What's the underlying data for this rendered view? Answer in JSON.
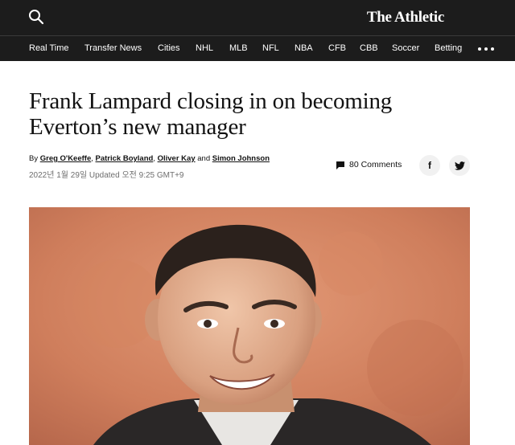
{
  "header": {
    "logo": "The Athletic",
    "search_icon": "search-icon"
  },
  "nav": {
    "items": [
      {
        "label": "Real Time"
      },
      {
        "label": "Transfer News"
      },
      {
        "label": "Cities"
      },
      {
        "label": "NHL"
      },
      {
        "label": "MLB"
      },
      {
        "label": "NFL"
      },
      {
        "label": "NBA"
      },
      {
        "label": "CFB"
      },
      {
        "label": "CBB"
      },
      {
        "label": "Soccer"
      },
      {
        "label": "Betting"
      }
    ],
    "more_icon": "more-icon"
  },
  "article": {
    "headline": "Frank Lampard closing in on becoming Everton’s new manager",
    "byline": {
      "prefix": "By",
      "authors": [
        "Greg O'Keeffe",
        "Patrick Boyland",
        "Oliver Kay",
        "Simon Johnson"
      ],
      "sep1": ",",
      "sep2": ",",
      "and": "and"
    },
    "timestamp": "2022년 1월 29일 Updated 오전 9:25 GMT+9",
    "comments_label": "80 Comments"
  },
  "share": {
    "facebook_glyph": "f",
    "twitter_icon": "twitter-icon"
  },
  "colors": {
    "header_bg": "#1c1c1c",
    "text": "#121212",
    "muted": "#6e6e6e"
  }
}
